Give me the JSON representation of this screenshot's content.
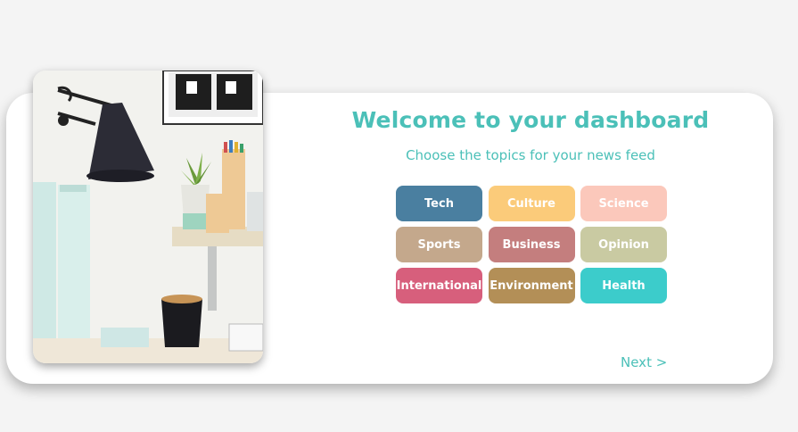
{
  "colors": {
    "accent": "#4bc0b8",
    "page_background": "#f4f4f4",
    "card_background": "#ffffff"
  },
  "welcome": {
    "title": "Welcome to your dashboard",
    "subtitle": "Choose the topics for your news feed"
  },
  "topics": [
    {
      "label": "Tech",
      "color": "#4a7fa0"
    },
    {
      "label": "Culture",
      "color": "#fbcb7a"
    },
    {
      "label": "Science",
      "color": "#fbc8bb"
    },
    {
      "label": "Sports",
      "color": "#c4a88c"
    },
    {
      "label": "Business",
      "color": "#c47e7e"
    },
    {
      "label": "Opinion",
      "color": "#c9caa2"
    },
    {
      "label": "International",
      "color": "#d75f7c"
    },
    {
      "label": "Environment",
      "color": "#b38f57"
    },
    {
      "label": "Health",
      "color": "#3ccccb"
    }
  ],
  "navigation": {
    "next_label": "Next >"
  },
  "image": {
    "description_icon": "desk-photo"
  }
}
